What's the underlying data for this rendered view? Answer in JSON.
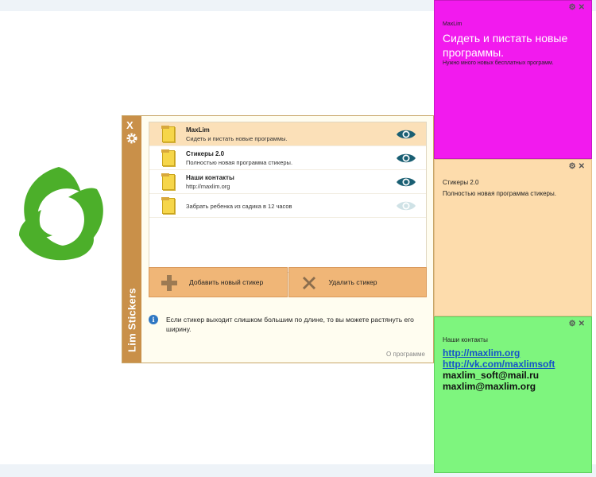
{
  "app": {
    "vertical_title": "Lim Stickers",
    "close_glyph": "X",
    "stickers": [
      {
        "title": "MaxLim",
        "subtitle": "Сидеть и пистать новые программы.",
        "visible": true,
        "selected": true
      },
      {
        "title": "Стикеры 2.0",
        "subtitle": "Полностью новая программа стикеры.",
        "visible": true,
        "selected": false
      },
      {
        "title": "Наши контакты",
        "subtitle": "http://maxlim.org",
        "visible": true,
        "selected": false
      },
      {
        "title": "",
        "subtitle": "Забрать ребенка из садика в 12 часов",
        "visible": false,
        "selected": false
      }
    ],
    "add_button": "Добавить новый стикер",
    "delete_button": "Удалить стикер",
    "info_text": "Если стикер выходит слишком большим по длине, то вы можете растянуть его ширину.",
    "about_link": "О программе"
  },
  "notes": {
    "magenta": {
      "small_title": "MaxLim",
      "big_text": "Сидеть и пистать новые программы.",
      "small_text": "Нужно много новых бесплатных программ.",
      "color": "#f21aee"
    },
    "peach": {
      "title": "Стикеры 2.0",
      "text": "Полностью новая программа стикеры.",
      "color": "#fddcac"
    },
    "green": {
      "title": "Наши контакты",
      "link1": "http://maxlim.org",
      "link2": "http://vk.com/maxlimsoft",
      "line3": "maxlim_soft@mail.ru",
      "line4": "maxlim@maxlim.org",
      "color": "#7ef57e"
    },
    "close_glyph": "✕",
    "gear_glyph": "⚙"
  },
  "colors": {
    "accent": "#c99049",
    "button": "#f0b677",
    "eye_active": "#1a5f73",
    "eye_inactive": "#cfe2e6",
    "logo": "#4caf2a"
  }
}
